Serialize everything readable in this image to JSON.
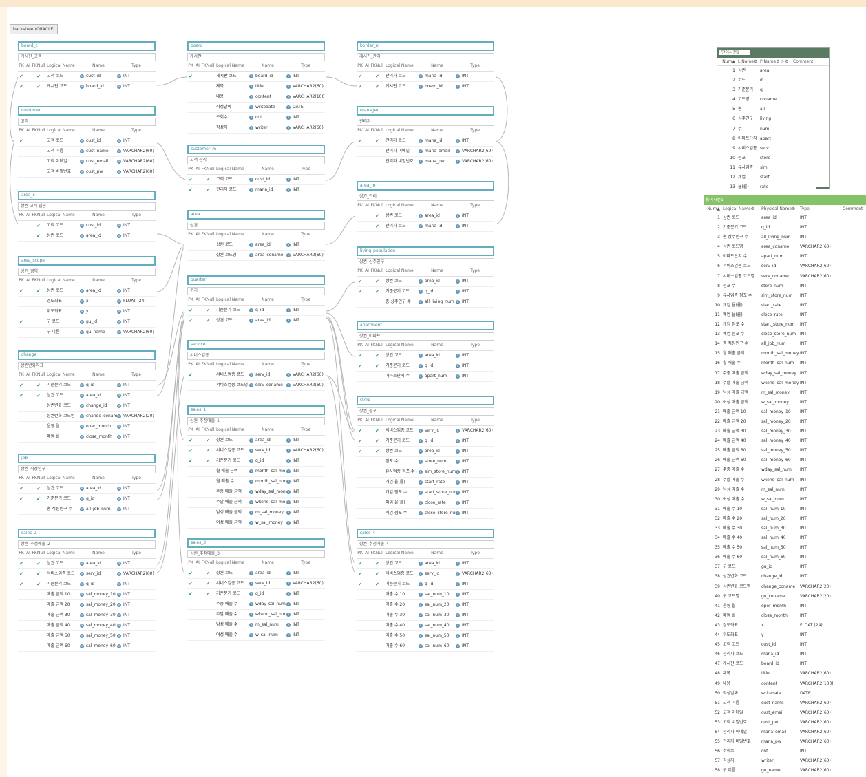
{
  "diagram_label": "backstreet(ORACLE)",
  "columns": {
    "pk": "PK",
    "ai": "AI",
    "fk": "FKNull",
    "logical": "Logical Name",
    "name": "Name",
    "type": "Type"
  },
  "tables": [
    {
      "id": "board_c",
      "logical": "게시판_고객",
      "rows": [
        [
          "✔",
          "✔",
          "고객 코드",
          "cust_id",
          "INT"
        ],
        [
          "✔",
          "✔",
          "게시판 코드",
          "board_id",
          "INT"
        ]
      ]
    },
    {
      "id": "customer",
      "logical": "고객",
      "rows": [
        [
          "✔",
          "",
          "고객 코드",
          "cust_id",
          "INT"
        ],
        [
          "",
          "",
          "고객 이름",
          "cust_name",
          "VARCHAR2(60)"
        ],
        [
          "",
          "",
          "고객 이메일",
          "cust_email",
          "VARCHAR2(60)"
        ],
        [
          "",
          "",
          "고객 비밀번호",
          "cust_pw",
          "VARCHAR2(60)"
        ]
      ]
    },
    {
      "id": "area_c",
      "logical": "상권 고객 랩핑",
      "rows": [
        [
          "",
          "✔",
          "고객 코드",
          "cust_id",
          "INT"
        ],
        [
          "",
          "✔",
          "상권 코드",
          "area_id",
          "INT"
        ]
      ]
    },
    {
      "id": "area_scope",
      "logical": "상권_영역",
      "rows": [
        [
          "✔",
          "✔",
          "상권 코드",
          "area_id",
          "INT"
        ],
        [
          "",
          "",
          "경도좌표",
          "x",
          "FLOAT (24)"
        ],
        [
          "",
          "",
          "위도좌표",
          "y",
          "INT"
        ],
        [
          "✔",
          "",
          "구 코드",
          "gu_id",
          "INT"
        ],
        [
          "",
          "",
          "구 이름",
          "gu_name",
          "VARCHAR2(60)"
        ]
      ]
    },
    {
      "id": "change",
      "logical": "상권변화지표",
      "rows": [
        [
          "✔",
          "✔",
          "기준분기 코드",
          "q_id",
          "INT"
        ],
        [
          "✔",
          "✔",
          "상권 코드",
          "area_id",
          "INT"
        ],
        [
          "",
          "",
          "상권변화 코드",
          "change_id",
          "INT"
        ],
        [
          "",
          "",
          "상권변화 코드명",
          "change_coname",
          "VARCHAR2(20)"
        ],
        [
          "",
          "",
          "운영 월",
          "oper_month",
          "INT"
        ],
        [
          "",
          "",
          "폐업 월",
          "close_month",
          "INT"
        ]
      ]
    },
    {
      "id": "job",
      "logical": "상권_직장인구",
      "rows": [
        [
          "✔",
          "✔",
          "상권 코드",
          "area_id",
          "INT"
        ],
        [
          "✔",
          "✔",
          "기준분기 코드",
          "q_id",
          "INT"
        ],
        [
          "",
          "",
          "총 직장인구 수",
          "all_job_num",
          "INT"
        ]
      ]
    },
    {
      "id": "sales_2",
      "logical": "상권_추정매출_2",
      "rows": [
        [
          "✔",
          "✔",
          "상권 코드",
          "area_id",
          "INT"
        ],
        [
          "✔",
          "✔",
          "서비스업종 코드",
          "serv_id",
          "VARCHAR2(60)"
        ],
        [
          "✔",
          "✔",
          "기준분기 코드",
          "q_id",
          "INT"
        ],
        [
          "",
          "",
          "매출 금액 10",
          "sal_money_10",
          "INT"
        ],
        [
          "",
          "",
          "매출 금액 20",
          "sal_money_20",
          "INT"
        ],
        [
          "",
          "",
          "매출 금액 30",
          "sal_money_30",
          "INT"
        ],
        [
          "",
          "",
          "매출 금액 40",
          "sal_money_40",
          "INT"
        ],
        [
          "",
          "",
          "매출 금액 50",
          "sal_money_50",
          "INT"
        ],
        [
          "",
          "",
          "매출 금액 60",
          "sal_money_60",
          "INT"
        ]
      ]
    },
    {
      "id": "board",
      "logical": "게시판",
      "rows": [
        [
          "✔",
          "",
          "게시판 코드",
          "board_id",
          "INT"
        ],
        [
          "",
          "",
          "제목",
          "title",
          "VARCHAR2(60)"
        ],
        [
          "",
          "",
          "내용",
          "content",
          "VARCHAR2(100)"
        ],
        [
          "",
          "",
          "작성날짜",
          "writedate",
          "DATE"
        ],
        [
          "",
          "",
          "조회수",
          "cnt",
          "INT"
        ],
        [
          "",
          "",
          "작성자",
          "writer",
          "VARCHAR2(60)"
        ]
      ]
    },
    {
      "id": "customer_m",
      "logical": "고객 관리",
      "rows": [
        [
          "✔",
          "✔",
          "고객 코드",
          "cust_id",
          "INT"
        ],
        [
          "✔",
          "✔",
          "관리자 코드",
          "mana_id",
          "INT"
        ]
      ]
    },
    {
      "id": "area",
      "logical": "상권",
      "rows": [
        [
          "",
          "",
          "상권 코드",
          "area_id",
          "INT"
        ],
        [
          "",
          "",
          "상권 코드명",
          "area_coname",
          "VARCHAR2(60)"
        ]
      ]
    },
    {
      "id": "quarter",
      "logical": "분기",
      "rows": [
        [
          "✔",
          "✔",
          "기준분기 코드",
          "q_id",
          "INT"
        ],
        [
          "✔",
          "✔",
          "상권 코드",
          "area_id",
          "INT"
        ]
      ]
    },
    {
      "id": "service",
      "logical": "서비스업종",
      "rows": [
        [
          "✔",
          "",
          "서비스업종 코드",
          "serv_id",
          "VARCHAR2(60)"
        ],
        [
          "",
          "",
          "서비스업종 코드명",
          "serv_coname",
          "VARCHAR2(60)"
        ]
      ]
    },
    {
      "id": "sales_1",
      "logical": "상권_추정매출_1",
      "rows": [
        [
          "✔",
          "✔",
          "상권 코드",
          "area_id",
          "INT"
        ],
        [
          "✔",
          "✔",
          "서비스업종 코드",
          "serv_id",
          "VARCHAR2(60)"
        ],
        [
          "✔",
          "✔",
          "기준분기 코드",
          "q_id",
          "INT"
        ],
        [
          "",
          "",
          "월 매출 금액",
          "month_sal_money",
          "INT"
        ],
        [
          "",
          "",
          "월 매출 수",
          "month_sal_num",
          "INT"
        ],
        [
          "",
          "",
          "주중 매출 금액",
          "wday_sal_money",
          "INT"
        ],
        [
          "",
          "",
          "주말 매출 금액",
          "wkend_sal_money",
          "INT"
        ],
        [
          "",
          "",
          "남성 매출 금액",
          "m_sal_money",
          "INT"
        ],
        [
          "",
          "",
          "여성 매출 금액",
          "w_sal_money",
          "INT"
        ]
      ]
    },
    {
      "id": "sales_3",
      "logical": "상권_추정매출_3",
      "rows": [
        [
          "✔",
          "✔",
          "상권 코드",
          "area_id",
          "INT"
        ],
        [
          "✔",
          "✔",
          "서비스업종 코드",
          "serv_id",
          "VARCHAR2(60)"
        ],
        [
          "✔",
          "✔",
          "기준분기 코드",
          "q_id",
          "INT"
        ],
        [
          "",
          "",
          "주중 매출 수",
          "wday_sal_num",
          "INT"
        ],
        [
          "",
          "",
          "주말 매출 수",
          "wkend_sal_num",
          "INT"
        ],
        [
          "",
          "",
          "남성 매출 수",
          "m_sal_num",
          "INT"
        ],
        [
          "",
          "",
          "여성 매출 수",
          "w_sal_num",
          "INT"
        ]
      ]
    },
    {
      "id": "border_m",
      "logical": "게시판_관리",
      "rows": [
        [
          "✔",
          "✔",
          "관리자 코드",
          "mana_id",
          "INT"
        ],
        [
          "✔",
          "✔",
          "게시판 코드",
          "board_id",
          "INT"
        ]
      ]
    },
    {
      "id": "manager",
      "logical": "관리자",
      "rows": [
        [
          "✔",
          "✔",
          "관리자 코드",
          "mana_id",
          "INT"
        ],
        [
          "",
          "",
          "관리자 이메일",
          "mana_email",
          "VARCHAR2(60)"
        ],
        [
          "",
          "",
          "관리자 비밀번호",
          "mana_pw",
          "VARCHAR2(60)"
        ]
      ]
    },
    {
      "id": "area_m",
      "logical": "상권_관리",
      "rows": [
        [
          "",
          "✔",
          "상권 코드",
          "area_id",
          "INT"
        ],
        [
          "",
          "✔",
          "관리자 코드",
          "mana_id",
          "INT"
        ]
      ]
    },
    {
      "id": "living_population",
      "logical": "상권_상주인구",
      "rows": [
        [
          "✔",
          "✔",
          "상권 코드",
          "area_id",
          "INT"
        ],
        [
          "✔",
          "✔",
          "기준분기 코드",
          "q_id",
          "INT"
        ],
        [
          "",
          "",
          "총 상주인구 수",
          "all_living_num",
          "INT"
        ]
      ]
    },
    {
      "id": "apartment",
      "logical": "상권_아파트",
      "rows": [
        [
          "✔",
          "✔",
          "상권 코드",
          "area_id",
          "INT"
        ],
        [
          "✔",
          "✔",
          "기준분기 코드",
          "q_id",
          "INT"
        ],
        [
          "",
          "",
          "아파트단지 수",
          "apart_num",
          "INT"
        ]
      ]
    },
    {
      "id": "store",
      "logical": "상권_점포",
      "rows": [
        [
          "✔",
          "✔",
          "서비스업종 코드",
          "serv_id",
          "VARCHAR2(60)"
        ],
        [
          "✔",
          "✔",
          "기준분기 코드",
          "q_id",
          "INT"
        ],
        [
          "✔",
          "✔",
          "상권 코드",
          "area_id",
          "INT"
        ],
        [
          "",
          "",
          "점포 수",
          "store_num",
          "INT"
        ],
        [
          "",
          "",
          "유사업종 점포 수",
          "sim_store_num",
          "INT"
        ],
        [
          "",
          "",
          "개업 율(률)",
          "start_rate",
          "INT"
        ],
        [
          "",
          "",
          "개업 점포 수",
          "start_store_num",
          "INT"
        ],
        [
          "",
          "",
          "폐업 율(률)",
          "close_rate",
          "INT"
        ],
        [
          "",
          "",
          "폐업 점포 수",
          "close_store_num",
          "INT"
        ]
      ]
    },
    {
      "id": "sales_4",
      "logical": "상권_추정매출_4",
      "rows": [
        [
          "✔",
          "✔",
          "상권 코드",
          "area_id",
          "INT"
        ],
        [
          "✔",
          "✔",
          "서비스업종 코드",
          "serv_id",
          "VARCHAR2(60)"
        ],
        [
          "✔",
          "✔",
          "기준분기 코드",
          "q_id",
          "INT"
        ],
        [
          "",
          "",
          "매출 수 10",
          "sal_num_10",
          "INT"
        ],
        [
          "",
          "",
          "매출 수 20",
          "sal_num_20",
          "INT"
        ],
        [
          "",
          "",
          "매출 수 30",
          "sal_num_30",
          "INT"
        ],
        [
          "",
          "",
          "매출 수 40",
          "sal_num_40",
          "INT"
        ],
        [
          "",
          "",
          "매출 수 50",
          "sal_num_50",
          "INT"
        ],
        [
          "",
          "",
          "매출 수 60",
          "sal_num_60",
          "INT"
        ]
      ]
    }
  ],
  "dict1": {
    "title": "단어사전1",
    "headers": [
      "Num▲",
      "L Name⚙",
      "P Name⚙ ⦸ ⚙",
      "Comment"
    ],
    "rows": [
      [
        "1",
        "상권",
        "area"
      ],
      [
        "2",
        "코드",
        "id"
      ],
      [
        "3",
        "기준분기",
        "q"
      ],
      [
        "4",
        "코드명",
        "coname"
      ],
      [
        "5",
        "총",
        "all"
      ],
      [
        "6",
        "상주인구",
        "living"
      ],
      [
        "7",
        "수",
        "num"
      ],
      [
        "8",
        "아파트단지",
        "apart"
      ],
      [
        "9",
        "서비스업종",
        "serv"
      ],
      [
        "10",
        "점포",
        "store"
      ],
      [
        "11",
        "유사업종",
        "sim"
      ],
      [
        "12",
        "개업",
        "start"
      ],
      [
        "13",
        "율(률)",
        "rate"
      ]
    ]
  },
  "dict2": {
    "title": "용어사전1",
    "headers": [
      "Num▲",
      "Logical Name⚙",
      "Physical Name⚙",
      "Type",
      "Comment"
    ],
    "rows": [
      [
        "1",
        "상권 코드",
        "area_id",
        "INT"
      ],
      [
        "2",
        "기준분기 코드",
        "q_id",
        "INT"
      ],
      [
        "3",
        "총 상주인구 수",
        "all_living_num",
        "INT"
      ],
      [
        "4",
        "상권 코드명",
        "area_coname",
        "VARCHAR2(60)"
      ],
      [
        "5",
        "아파트단지 수",
        "apart_num",
        "INT"
      ],
      [
        "6",
        "서비스업종 코드",
        "serv_id",
        "VARCHAR2(60)"
      ],
      [
        "7",
        "서비스업종 코드명",
        "serv_coname",
        "VARCHAR2(60)"
      ],
      [
        "8",
        "점포 수",
        "store_num",
        "INT"
      ],
      [
        "9",
        "유사업종 점포 수",
        "sim_store_num",
        "INT"
      ],
      [
        "10",
        "개업 율(률)",
        "start_rate",
        "INT"
      ],
      [
        "11",
        "폐업 율(률)",
        "close_rate",
        "INT"
      ],
      [
        "12",
        "개업 점포 수",
        "start_store_num",
        "INT"
      ],
      [
        "13",
        "폐업 점포 수",
        "close_store_num",
        "INT"
      ],
      [
        "14",
        "총 직장인구 수",
        "all_job_num",
        "INT"
      ],
      [
        "15",
        "월 매출 금액",
        "month_sal_money",
        "INT"
      ],
      [
        "16",
        "월 매출 수",
        "month_sal_num",
        "INT"
      ],
      [
        "17",
        "주중 매출 금액",
        "wday_sal_money",
        "INT"
      ],
      [
        "18",
        "주말 매출 금액",
        "wkend_sal_money",
        "INT"
      ],
      [
        "19",
        "남성 매출 금액",
        "m_sal_money",
        "INT"
      ],
      [
        "20",
        "여성 매출 금액",
        "w_sal_money",
        "INT"
      ],
      [
        "21",
        "매출 금액 10",
        "sal_money_10",
        "INT"
      ],
      [
        "22",
        "매출 금액 20",
        "sal_money_20",
        "INT"
      ],
      [
        "23",
        "매출 금액 30",
        "sal_money_30",
        "INT"
      ],
      [
        "24",
        "매출 금액 40",
        "sal_money_40",
        "INT"
      ],
      [
        "25",
        "매출 금액 50",
        "sal_money_50",
        "INT"
      ],
      [
        "26",
        "매출 금액 60",
        "sal_money_60",
        "INT"
      ],
      [
        "27",
        "주중 매출 수",
        "wday_sal_num",
        "INT"
      ],
      [
        "28",
        "주말 매출 수",
        "wkend_sal_num",
        "INT"
      ],
      [
        "29",
        "남성 매출 수",
        "m_sal_num",
        "INT"
      ],
      [
        "30",
        "여성 매출 수",
        "w_sal_num",
        "INT"
      ],
      [
        "31",
        "매출 수 10",
        "sal_num_10",
        "INT"
      ],
      [
        "32",
        "매출 수 20",
        "sal_num_20",
        "INT"
      ],
      [
        "33",
        "매출 수 30",
        "sal_num_30",
        "INT"
      ],
      [
        "34",
        "매출 수 40",
        "sal_num_40",
        "INT"
      ],
      [
        "35",
        "매출 수 50",
        "sal_num_50",
        "INT"
      ],
      [
        "36",
        "매출 수 60",
        "sal_num_60",
        "INT"
      ],
      [
        "37",
        "구 코드",
        "gu_id",
        "INT"
      ],
      [
        "38",
        "상권변화 코드",
        "change_id",
        "INT"
      ],
      [
        "39",
        "상권변화 코드명",
        "change_coname",
        "VARCHAR2(20)"
      ],
      [
        "40",
        "구 코드명",
        "gu_coname",
        "VARCHAR2(20)"
      ],
      [
        "41",
        "운영 월",
        "oper_month",
        "INT"
      ],
      [
        "42",
        "폐업 월",
        "close_month",
        "INT"
      ],
      [
        "43",
        "경도좌표",
        "x",
        "FLOAT (24)"
      ],
      [
        "44",
        "위도좌표",
        "y",
        "INT"
      ],
      [
        "45",
        "고객 코드",
        "cust_id",
        "INT"
      ],
      [
        "46",
        "관리자 코드",
        "mana_id",
        "INT"
      ],
      [
        "47",
        "게시판 코드",
        "board_id",
        "INT"
      ],
      [
        "48",
        "제목",
        "title",
        "VARCHAR2(60)"
      ],
      [
        "49",
        "내용",
        "content",
        "VARCHAR2(100)"
      ],
      [
        "50",
        "작성날짜",
        "writedate",
        "DATE"
      ],
      [
        "51",
        "고객 이름",
        "cust_name",
        "VARCHAR2(60)"
      ],
      [
        "52",
        "고객 이메일",
        "cust_email",
        "VARCHAR2(60)"
      ],
      [
        "53",
        "고객 비밀번호",
        "cust_pw",
        "VARCHAR2(60)"
      ],
      [
        "54",
        "관리자 이메일",
        "mana_email",
        "VARCHAR2(60)"
      ],
      [
        "55",
        "관리자 비밀번호",
        "mana_pw",
        "VARCHAR2(60)"
      ],
      [
        "56",
        "조회수",
        "cnt",
        "INT"
      ],
      [
        "57",
        "작성자",
        "writer",
        "VARCHAR2(60)"
      ],
      [
        "58",
        "구 이름",
        "gu_name",
        "VARCHAR2(60)"
      ]
    ]
  },
  "colors": {
    "accent": "#62aebc",
    "check": "#2b9a54",
    "column_icon": "#5d95b5",
    "dict1_header": "#5b7a63",
    "dict2_header": "#86c268"
  }
}
